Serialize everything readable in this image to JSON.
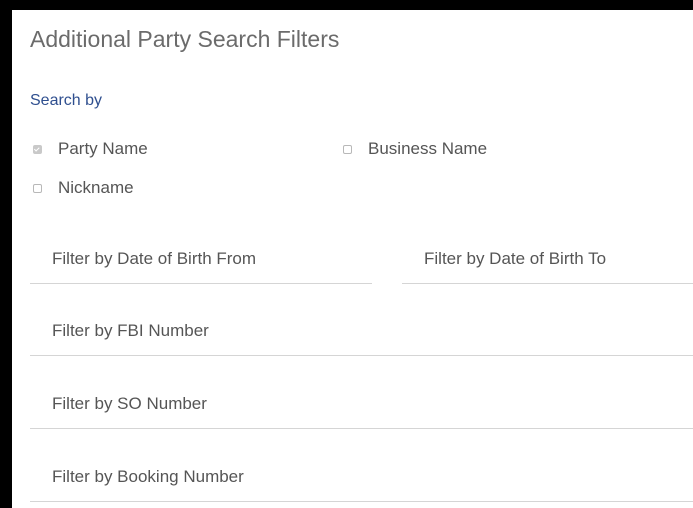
{
  "panel": {
    "title": "Additional Party Search Filters",
    "search_by_label": "Search by"
  },
  "checkboxes": [
    {
      "label": "Party Name",
      "checked": true
    },
    {
      "label": "Business Name",
      "checked": false
    },
    {
      "label": "Nickname",
      "checked": false
    }
  ],
  "filters": {
    "dob_from": {
      "placeholder": "Filter by Date of Birth From",
      "value": ""
    },
    "dob_to": {
      "placeholder": "Filter by Date of Birth To",
      "value": ""
    },
    "fbi_number": {
      "placeholder": "Filter by FBI Number",
      "value": ""
    },
    "so_number": {
      "placeholder": "Filter by SO Number",
      "value": ""
    },
    "booking_number": {
      "placeholder": "Filter by Booking Number",
      "value": ""
    }
  },
  "colors": {
    "title": "#6b6b6b",
    "section_label": "#2f4f8f",
    "text": "#555555",
    "underline": "#d5d5d5",
    "frame": "#000000"
  }
}
